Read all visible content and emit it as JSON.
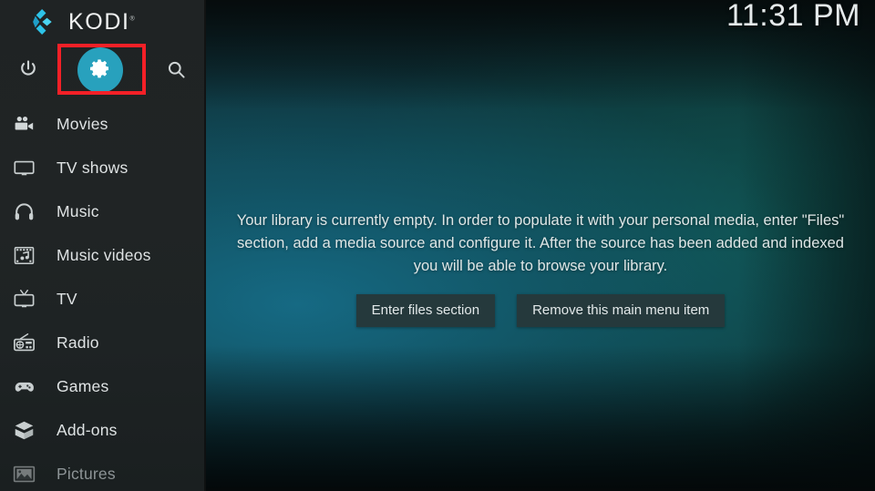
{
  "app": {
    "brand_name": "KODI",
    "brand_tm": "®",
    "logo_icon": "kodi-logo-icon"
  },
  "statusbar": {
    "clock": "11:31 PM"
  },
  "sidebar": {
    "top_actions": [
      {
        "name": "power",
        "icon": "power-icon",
        "label": "Power"
      },
      {
        "name": "settings",
        "icon": "gear-icon",
        "label": "Settings",
        "highlighted": true,
        "accent": "#28a1bd"
      },
      {
        "name": "search",
        "icon": "search-icon",
        "label": "Search"
      }
    ],
    "items": [
      {
        "label": "Movies",
        "icon": "movie-camera-icon",
        "dim": false
      },
      {
        "label": "TV shows",
        "icon": "monitor-icon",
        "dim": false
      },
      {
        "label": "Music",
        "icon": "headphones-icon",
        "dim": false
      },
      {
        "label": "Music videos",
        "icon": "film-music-icon",
        "dim": false
      },
      {
        "label": "TV",
        "icon": "television-icon",
        "dim": false
      },
      {
        "label": "Radio",
        "icon": "radio-icon",
        "dim": false
      },
      {
        "label": "Games",
        "icon": "gamepad-icon",
        "dim": false
      },
      {
        "label": "Add-ons",
        "icon": "addon-box-icon",
        "dim": false
      },
      {
        "label": "Pictures",
        "icon": "pictures-icon",
        "dim": true
      }
    ]
  },
  "main": {
    "empty_message": "Your library is currently empty. In order to populate it with your personal media, enter \"Files\" section, add a media source and configure it. After the source has been added and indexed you will be able to browse your library.",
    "buttons": {
      "enter_files": "Enter files section",
      "remove_item": "Remove this main menu item"
    }
  },
  "annotation": {
    "highlight_color": "#f42027",
    "target": "settings"
  }
}
